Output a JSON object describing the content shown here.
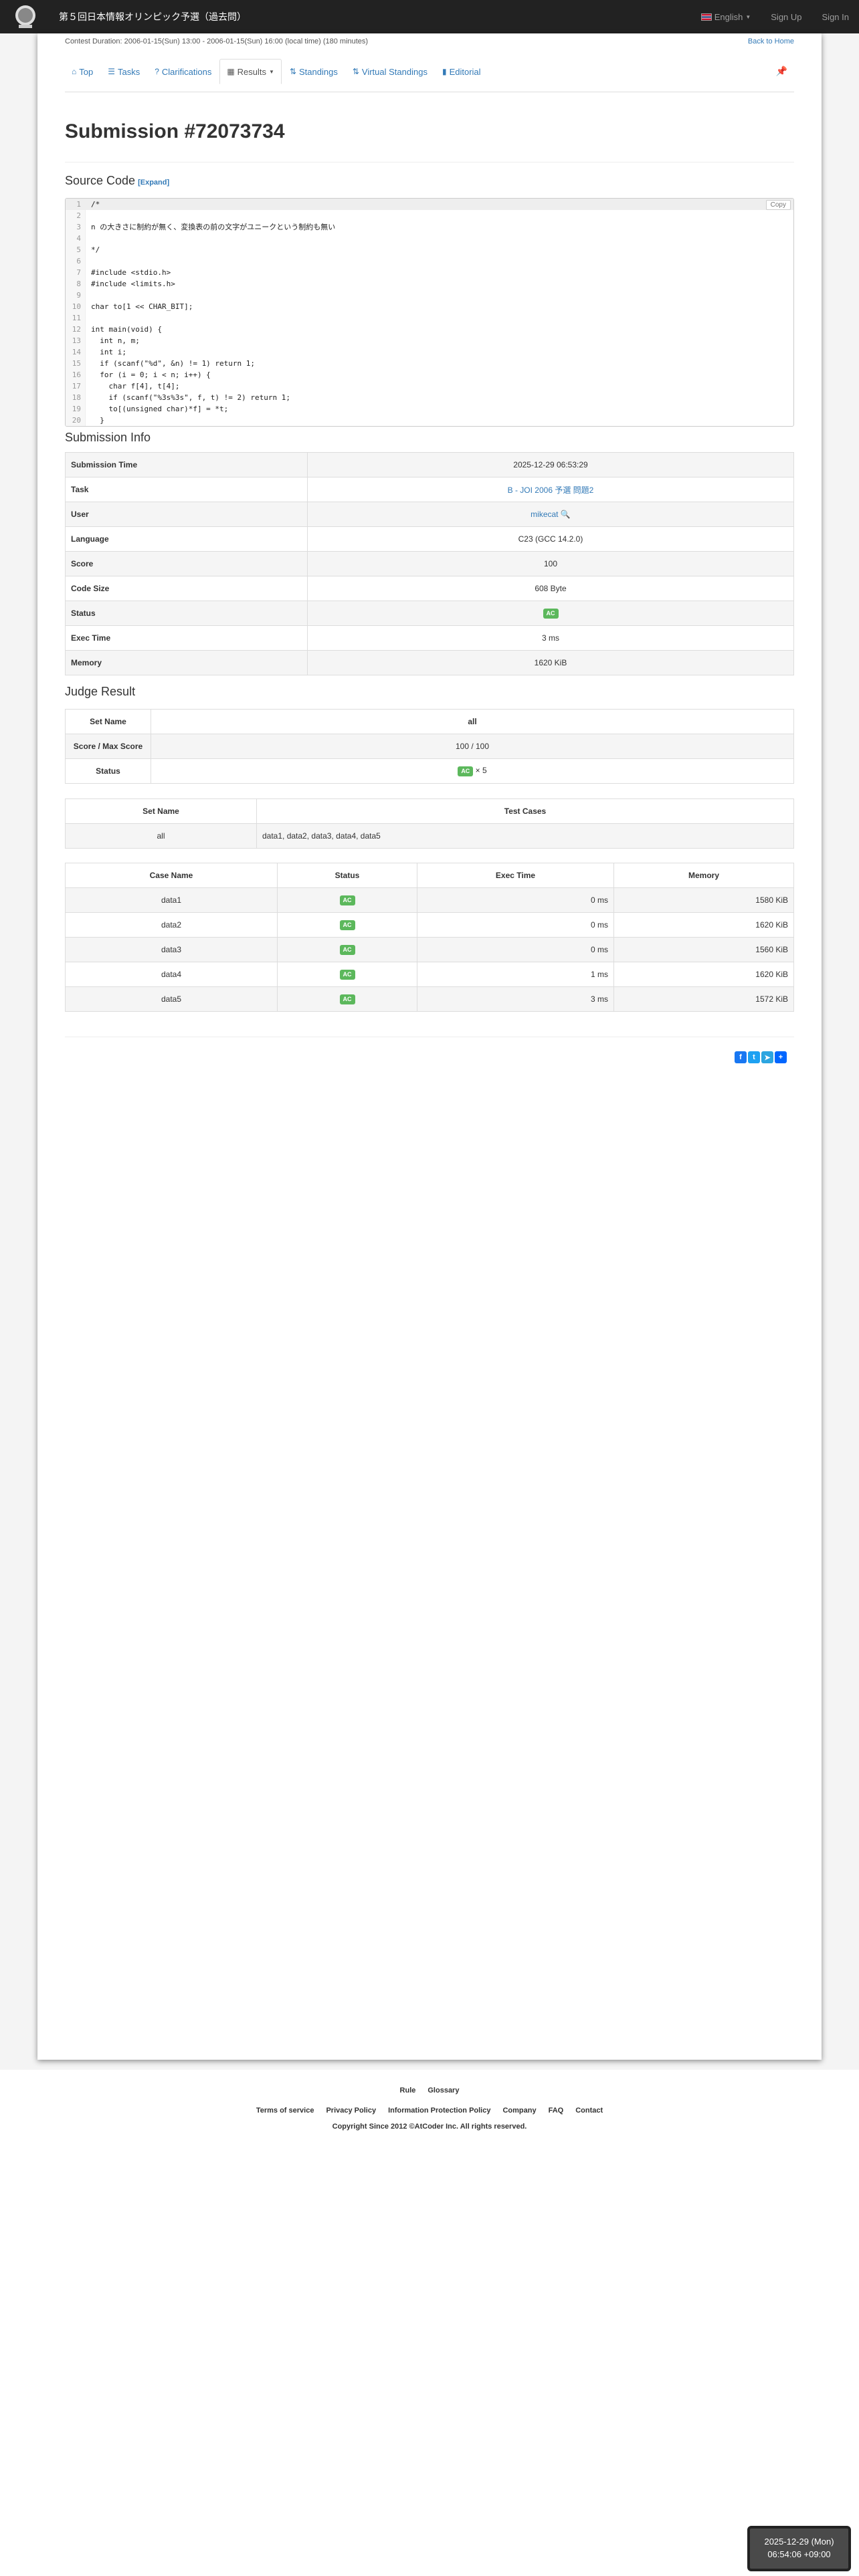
{
  "navbar": {
    "brand": "第５回日本情報オリンピック予選（過去問）",
    "language": "English",
    "sign_up": "Sign Up",
    "sign_in": "Sign In"
  },
  "contest": {
    "duration": "Contest Duration: 2006-01-15(Sun) 13:00 - 2006-01-15(Sun) 16:00 (local time) (180 minutes)",
    "back_home": "Back to Home"
  },
  "tabs": [
    {
      "label": "Top",
      "icon": "home-icon"
    },
    {
      "label": "Tasks",
      "icon": "list-icon"
    },
    {
      "label": "Clarifications",
      "icon": "question-icon"
    },
    {
      "label": "Results",
      "icon": "table-icon"
    },
    {
      "label": "Standings",
      "icon": "sort-icon"
    },
    {
      "label": "Virtual Standings",
      "icon": "sort-icon"
    },
    {
      "label": "Editorial",
      "icon": "book-icon"
    }
  ],
  "page_title": "Submission #72073734",
  "source": {
    "heading": "Source Code",
    "expand": "[Expand]",
    "copy": "Copy",
    "lines": [
      {
        "n": "1",
        "t": "/*"
      },
      {
        "n": "2",
        "t": ""
      },
      {
        "n": "3",
        "t": "n の大きさに制約が無く、変換表の前の文字がユニークという制約も無い"
      },
      {
        "n": "4",
        "t": ""
      },
      {
        "n": "5",
        "t": "*/"
      },
      {
        "n": "6",
        "t": ""
      },
      {
        "n": "7",
        "t": "#include <stdio.h>"
      },
      {
        "n": "8",
        "t": "#include <limits.h>"
      },
      {
        "n": "9",
        "t": ""
      },
      {
        "n": "10",
        "t": "char to[1 << CHAR_BIT];"
      },
      {
        "n": "11",
        "t": ""
      },
      {
        "n": "12",
        "t": "int main(void) {"
      },
      {
        "n": "13",
        "t": "  int n, m;"
      },
      {
        "n": "14",
        "t": "  int i;"
      },
      {
        "n": "15",
        "t": "  if (scanf(\"%d\", &n) != 1) return 1;"
      },
      {
        "n": "16",
        "t": "  for (i = 0; i < n; i++) {"
      },
      {
        "n": "17",
        "t": "    char f[4], t[4];"
      },
      {
        "n": "18",
        "t": "    if (scanf(\"%3s%3s\", f, t) != 2) return 1;"
      },
      {
        "n": "19",
        "t": "    to[(unsigned char)*f] = *t;"
      },
      {
        "n": "20",
        "t": "  }"
      }
    ]
  },
  "info": {
    "heading": "Submission Info",
    "submission_time_label": "Submission Time",
    "submission_time": "2025-12-29 06:53:29",
    "task_label": "Task",
    "task": "B - JOI 2006 予選 問題2",
    "user_label": "User",
    "user": "mikecat",
    "language_label": "Language",
    "language": "C23 (GCC 14.2.0)",
    "score_label": "Score",
    "score": "100",
    "code_size_label": "Code Size",
    "code_size": "608 Byte",
    "status_label": "Status",
    "status": "AC",
    "exec_time_label": "Exec Time",
    "exec_time": "3 ms",
    "memory_label": "Memory",
    "memory": "1620 KiB"
  },
  "judge": {
    "heading": "Judge Result",
    "set_name_label": "Set Name",
    "set_name": "all",
    "score_label": "Score / Max Score",
    "score": "100 / 100",
    "status_label": "Status",
    "status_badge": "AC",
    "status_count": "× 5",
    "sets_header_name": "Set Name",
    "sets_header_cases": "Test Cases",
    "sets_name": "all",
    "sets_cases": "data1, data2, data3, data4, data5"
  },
  "cases": {
    "headers": [
      "Case Name",
      "Status",
      "Exec Time",
      "Memory"
    ],
    "rows": [
      {
        "name": "data1",
        "status": "AC",
        "time": "0 ms",
        "memory": "1580 KiB"
      },
      {
        "name": "data2",
        "status": "AC",
        "time": "0 ms",
        "memory": "1620 KiB"
      },
      {
        "name": "data3",
        "status": "AC",
        "time": "0 ms",
        "memory": "1560 KiB"
      },
      {
        "name": "data4",
        "status": "AC",
        "time": "1 ms",
        "memory": "1620 KiB"
      },
      {
        "name": "data5",
        "status": "AC",
        "time": "3 ms",
        "memory": "1572 KiB"
      }
    ]
  },
  "footer": {
    "links1": [
      "Rule",
      "Glossary"
    ],
    "links2": [
      "Terms of service",
      "Privacy Policy",
      "Information Protection Policy",
      "Company",
      "FAQ",
      "Contact"
    ],
    "copyright": "Copyright Since 2012 ©AtCoder Inc. All rights reserved."
  },
  "clock": {
    "date": "2025-12-29 (Mon)",
    "time": "06:54:06 +09:00"
  },
  "colors": {
    "navbar": "#222222",
    "link": "#337ab7",
    "badge_ac": "#5cb85c"
  }
}
